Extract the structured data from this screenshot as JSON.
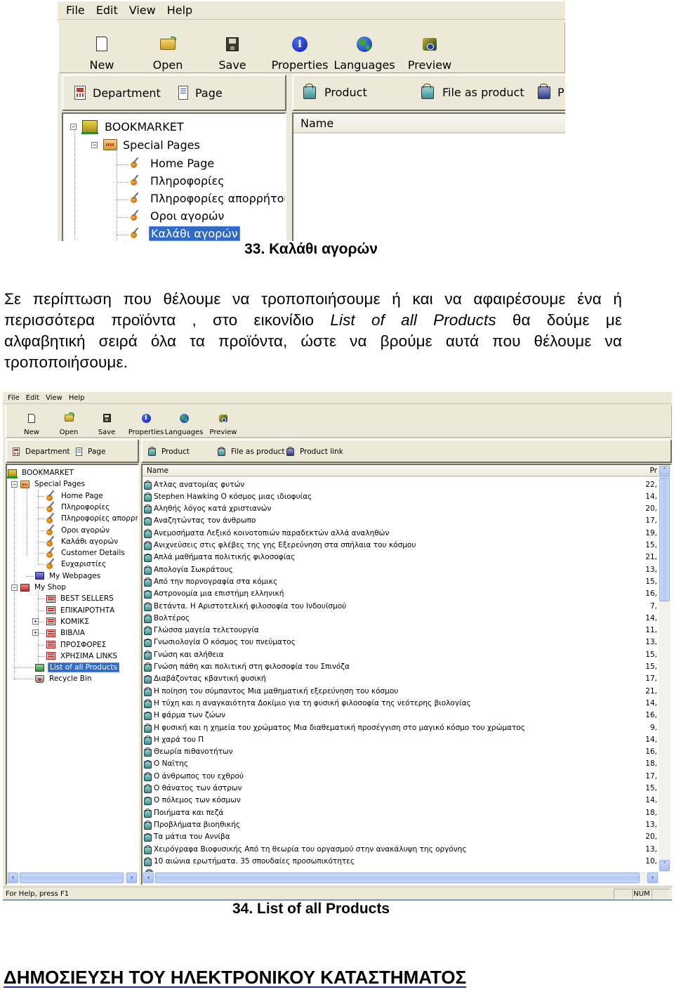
{
  "screenshot1": {
    "menu": [
      "File",
      "Edit",
      "View",
      "Help"
    ],
    "toolbar": [
      {
        "label": "New",
        "icon": "new-document-icon"
      },
      {
        "label": "Open",
        "icon": "open-folder-icon"
      },
      {
        "label": "Save",
        "icon": "floppy-disk-icon"
      },
      {
        "label": "Properties",
        "icon": "info-icon"
      },
      {
        "label": "Languages",
        "icon": "globe-icon"
      },
      {
        "label": "Preview",
        "icon": "preview-eye-icon"
      }
    ],
    "left_bar": [
      {
        "label": "Department",
        "icon": "department-icon"
      },
      {
        "label": "Page",
        "icon": "page-icon"
      }
    ],
    "right_bar": [
      {
        "label": "Product",
        "icon": "product-icon"
      },
      {
        "label": "File as product",
        "icon": "file-product-icon"
      },
      {
        "label": "P",
        "icon": "product-link-icon"
      }
    ],
    "tree": {
      "root": "BOOKMARKET",
      "folder": "Special Pages",
      "pages": [
        "Home Page",
        "Πληροφορίες",
        "Πληροφορίες απορρήτου",
        "Οροι αγορών",
        "Καλάθι αγορών"
      ],
      "selected": "Καλάθι αγορών"
    },
    "list_header": {
      "name": "Name"
    }
  },
  "caption1": "33. Καλάθι αγορών",
  "paragraph": {
    "line1": "Σε περίπτωση που θέλουμε να τροποποιήσουμε ή και να αφαιρέσουμε ένα ή",
    "line2_before": "περισσότερα προϊόντα , στο εικονίδιο ",
    "line2_italic": "List of all Products",
    "line2_after": " θα δούμε με",
    "line3": "αλφαβητική σειρά όλα τα προϊόντα, ώστε να βρούμε αυτά που θέλουμε να",
    "line4": "τροποποιήσουμε."
  },
  "screenshot2": {
    "menu": [
      "File",
      "Edit",
      "View",
      "Help"
    ],
    "toolbar": [
      {
        "label": "New",
        "icon": "new-document-icon"
      },
      {
        "label": "Open",
        "icon": "open-folder-icon"
      },
      {
        "label": "Save",
        "icon": "floppy-disk-icon"
      },
      {
        "label": "Properties",
        "icon": "info-icon"
      },
      {
        "label": "Languages",
        "icon": "globe-icon"
      },
      {
        "label": "Preview",
        "icon": "preview-eye-icon"
      }
    ],
    "left_bar": [
      {
        "label": "Department",
        "icon": "department-icon"
      },
      {
        "label": "Page",
        "icon": "page-icon"
      }
    ],
    "right_bar": [
      {
        "label": "Product",
        "icon": "product-icon"
      },
      {
        "label": "File as product",
        "icon": "file-product-icon"
      },
      {
        "label": "Product link",
        "icon": "product-link-icon"
      }
    ],
    "tree": {
      "root": "BOOKMARKET",
      "special_pages": "Special Pages",
      "pages": [
        "Home Page",
        "Πληροφορίες",
        "Πληροφορίες απορρήτου",
        "Οροι αγορών",
        "Καλάθι αγορών",
        "Customer Details",
        "Ευχαριστίες"
      ],
      "my_webpages": "My Webpages",
      "my_shop": "My Shop",
      "departments": [
        {
          "label": "BEST SELLERS",
          "expandable": false
        },
        {
          "label": "ΕΠΙΚΑΙΡΟΤΗΤΑ",
          "expandable": false
        },
        {
          "label": "ΚΟΜΙΚΣ",
          "expandable": true
        },
        {
          "label": "ΒΙΒΛΙΑ",
          "expandable": true
        },
        {
          "label": "ΠΡΟΣΦΟΡΕΣ",
          "expandable": false
        },
        {
          "label": "ΧΡΗΣΙΜΑ LINKS",
          "expandable": false
        }
      ],
      "list_all": "List of all Products",
      "recycle_bin": "Recycle Bin",
      "selected": "List of all Products"
    },
    "list_header": {
      "name": "Name",
      "price": "Pr"
    },
    "products": [
      {
        "name": "Ατλας ανατομίας φυτών",
        "price": "22,"
      },
      {
        "name": "Stephen Hawking Ο κόσμος μιας ιδιοφυίας",
        "price": "14,"
      },
      {
        "name": "Αληθής λόγος κατά χριστιανών",
        "price": "20,"
      },
      {
        "name": "Αναζητώντας τον άνθρωπο",
        "price": "17,"
      },
      {
        "name": "Ανεμοσήματα Λεξικό κοινοτοπιών παραδεκτών αλλά αναληθών",
        "price": "19,"
      },
      {
        "name": "Ανιχνεύσεις στις φλέβες της γης Εξερεύνηση στα σπήλαια του κόσμου",
        "price": "15,"
      },
      {
        "name": "Απλά μαθήματα πολιτικής φιλοσοφίας",
        "price": "21,"
      },
      {
        "name": "Απολογία Σωκράτους",
        "price": "13,"
      },
      {
        "name": "Από την πορνογραφία στα κόμικς",
        "price": "15,"
      },
      {
        "name": "Αστρονομία μια επιστήμη ελληνική",
        "price": "16,"
      },
      {
        "name": "Βετάντα. Η Αριστοτελική φιλοσοφία του Ινδουϊσμού",
        "price": "7,"
      },
      {
        "name": "Βολτέρος",
        "price": "14,"
      },
      {
        "name": "Γλώσσα μαγεία τελετουργία",
        "price": "11,"
      },
      {
        "name": "Γνωσιολογία Ο κόσμος του πνεύματος",
        "price": "13,"
      },
      {
        "name": "Γνώση και αλήθεια",
        "price": "15,"
      },
      {
        "name": "Γνώση πάθη και πολιτική στη φιλοσοφία του Σπινόζα",
        "price": "15,"
      },
      {
        "name": "Διαβάζοντας κβαντική φυσική",
        "price": "17,"
      },
      {
        "name": "Η ποίηση του σύμπαντος Μια μαθηματική εξερεύνηση του κόσμου",
        "price": "21,"
      },
      {
        "name": "Η τύχη και η αναγκαιότητα Δοκίμιο για τη φυσική φιλοσοφία της νεότερης βιολογίας",
        "price": "14,"
      },
      {
        "name": "Η φάρμα των ζώων",
        "price": "16,"
      },
      {
        "name": "Η φυσική και η χημεία του χρώματος Μια διαθεματική προσέγγιση στο μαγικό κόσμο του χρώματος",
        "price": "9,"
      },
      {
        "name": "Η χαρά του Π",
        "price": "14,"
      },
      {
        "name": "Θεωρία πιθανοτήτων",
        "price": "16,"
      },
      {
        "name": "Ο Ναΐτης",
        "price": "18,"
      },
      {
        "name": "Ο άνθρωπος του εχθρού",
        "price": "17,"
      },
      {
        "name": "Ο θάνατος των άστρων",
        "price": "15,"
      },
      {
        "name": "Ο πόλεμος των κόσμων",
        "price": "14,"
      },
      {
        "name": "Ποιήματα και πεζά",
        "price": "18,"
      },
      {
        "name": "Προβλήματα βιοηθικής",
        "price": "13,"
      },
      {
        "name": "Τα μάτια του Αννίβα",
        "price": "20,"
      },
      {
        "name": "Χειρόγραφα Βιοφυσικής Από τη θεωρία του οργασμού στην ανακάλυψη της οργόνης",
        "price": "13,"
      },
      {
        "name": "10 αιώνια ερωτήματα. 35 σπουδαίες προσωπικότητες",
        "price": "10,"
      }
    ],
    "status": {
      "help": "For Help, press F1",
      "num": "NUM"
    }
  },
  "caption2": "34. List of all Products",
  "section_heading": "ΔΗΜΟΣΙΕΥΣΗ ΤΟΥ ΗΛΕΚΤΡΟΝΙΚΟΥ ΚΑΤΑΣΤΗΜΑΤΟΣ",
  "colors": {
    "selection": "#316ac5",
    "heading_underline": "#1a2aa8",
    "window_bg": "#ece9d8"
  }
}
